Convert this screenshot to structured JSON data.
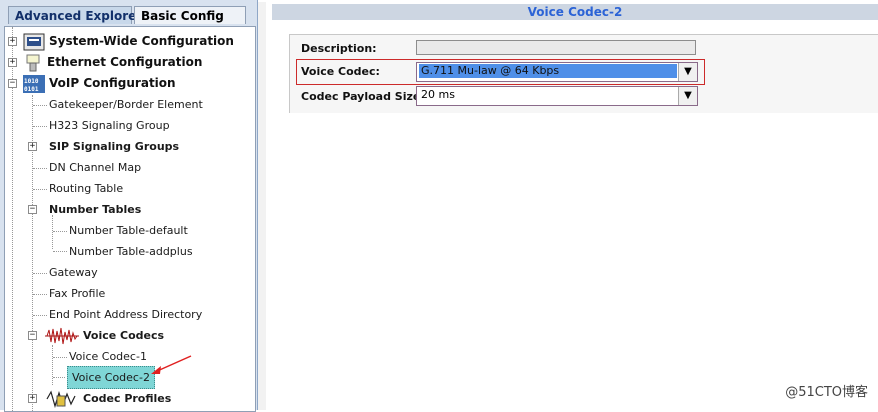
{
  "tabs": {
    "advanced": "Advanced Explore",
    "basic": "Basic Config"
  },
  "tree": {
    "system_wide": "System-Wide Configuration",
    "ethernet": "Ethernet Configuration",
    "voip": "VoIP Configuration",
    "gatekeeper": "Gatekeeper/Border Element",
    "h323": "H323 Signaling Group",
    "sip_groups": "SIP Signaling Groups",
    "dn_map": "DN Channel Map",
    "routing": "Routing Table",
    "number_tables": "Number Tables",
    "number_default": "Number Table-default",
    "number_addplus": "Number Table-addplus",
    "gateway": "Gateway",
    "fax": "Fax Profile",
    "endpoint": "End Point Address Directory",
    "voice_codecs": "Voice Codecs",
    "voice_codec_1": "Voice Codec-1",
    "voice_codec_2": "Voice Codec-2",
    "codec_profiles": "Codec Profiles"
  },
  "right": {
    "header": "Voice Codec-2",
    "description_label": "Description:",
    "description_value": "",
    "voice_codec_label": "Voice Codec:",
    "voice_codec_value": "G.711 Mu-law @ 64 Kbps",
    "payload_label": "Codec Payload Size:",
    "payload_value": "20 ms"
  },
  "watermark": "@51CTO博客",
  "colors": {
    "header_text": "#2b63d6",
    "selection": "#7fd6d6",
    "highlight": "#cc2a2a"
  }
}
